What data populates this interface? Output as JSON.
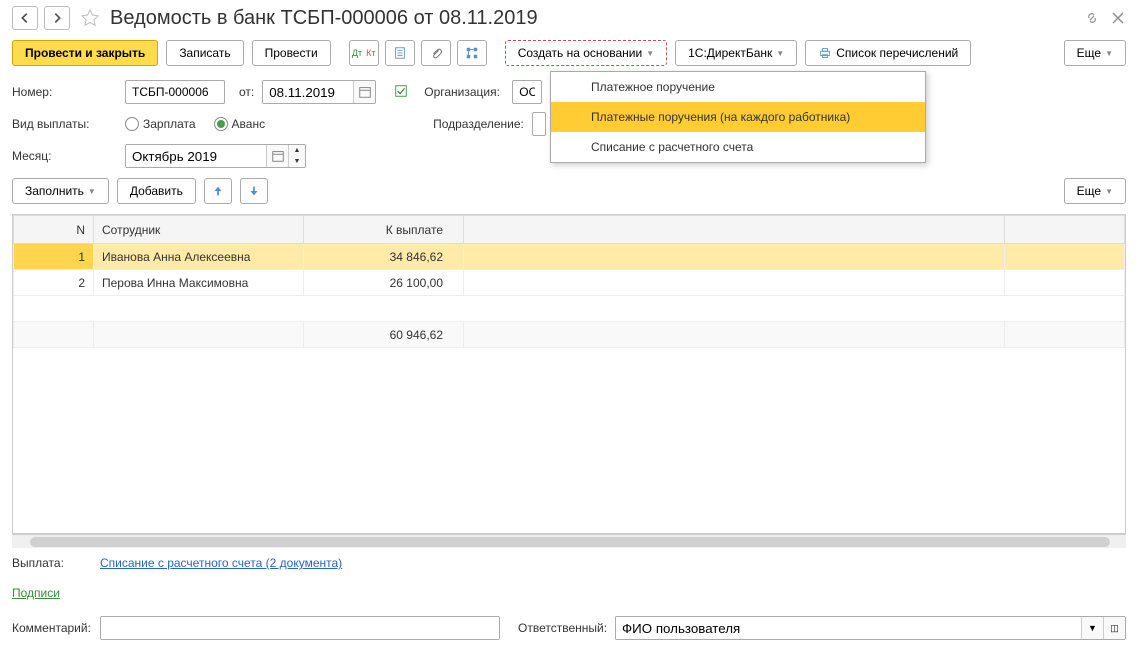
{
  "header": {
    "title": "Ведомость в банк ТСБП-000006 от 08.11.2019"
  },
  "toolbar": {
    "post_close": "Провести и закрыть",
    "save": "Записать",
    "post": "Провести",
    "create_based": "Создать на основании",
    "direct_bank": "1С:ДиректБанк",
    "transfer_list": "Список перечислений",
    "more": "Еще"
  },
  "form": {
    "number_label": "Номер:",
    "number_value": "ТСБП-000006",
    "from_label": "от:",
    "date_value": "08.11.2019",
    "org_label": "Организация:",
    "org_value": "ООО",
    "payment_type_label": "Вид выплаты:",
    "salary_label": "Зарплата",
    "advance_label": "Аванс",
    "dept_label": "Подразделение:",
    "month_label": "Месяц:",
    "month_value": "Октябрь 2019"
  },
  "sub": {
    "fill": "Заполнить",
    "add": "Добавить",
    "more": "Еще"
  },
  "table": {
    "col_n": "N",
    "col_emp": "Сотрудник",
    "col_pay": "К выплате",
    "rows": [
      {
        "n": "1",
        "emp": "Иванова Анна Алексеевна",
        "pay": "34 846,62"
      },
      {
        "n": "2",
        "emp": "Перова Инна Максимовна",
        "pay": "26 100,00"
      }
    ],
    "total": "60 946,62"
  },
  "footer": {
    "payment_label": "Выплата:",
    "payment_link": "Списание с расчетного счета (2 документа)",
    "signatures": "Подписи",
    "comment_label": "Комментарий:",
    "responsible_label": "Ответственный:",
    "responsible_value": "ФИО пользователя"
  },
  "dropdown": {
    "item1": "Платежное поручение",
    "item2": "Платежные поручения (на каждого работника)",
    "item3": "Списание с расчетного счета"
  }
}
